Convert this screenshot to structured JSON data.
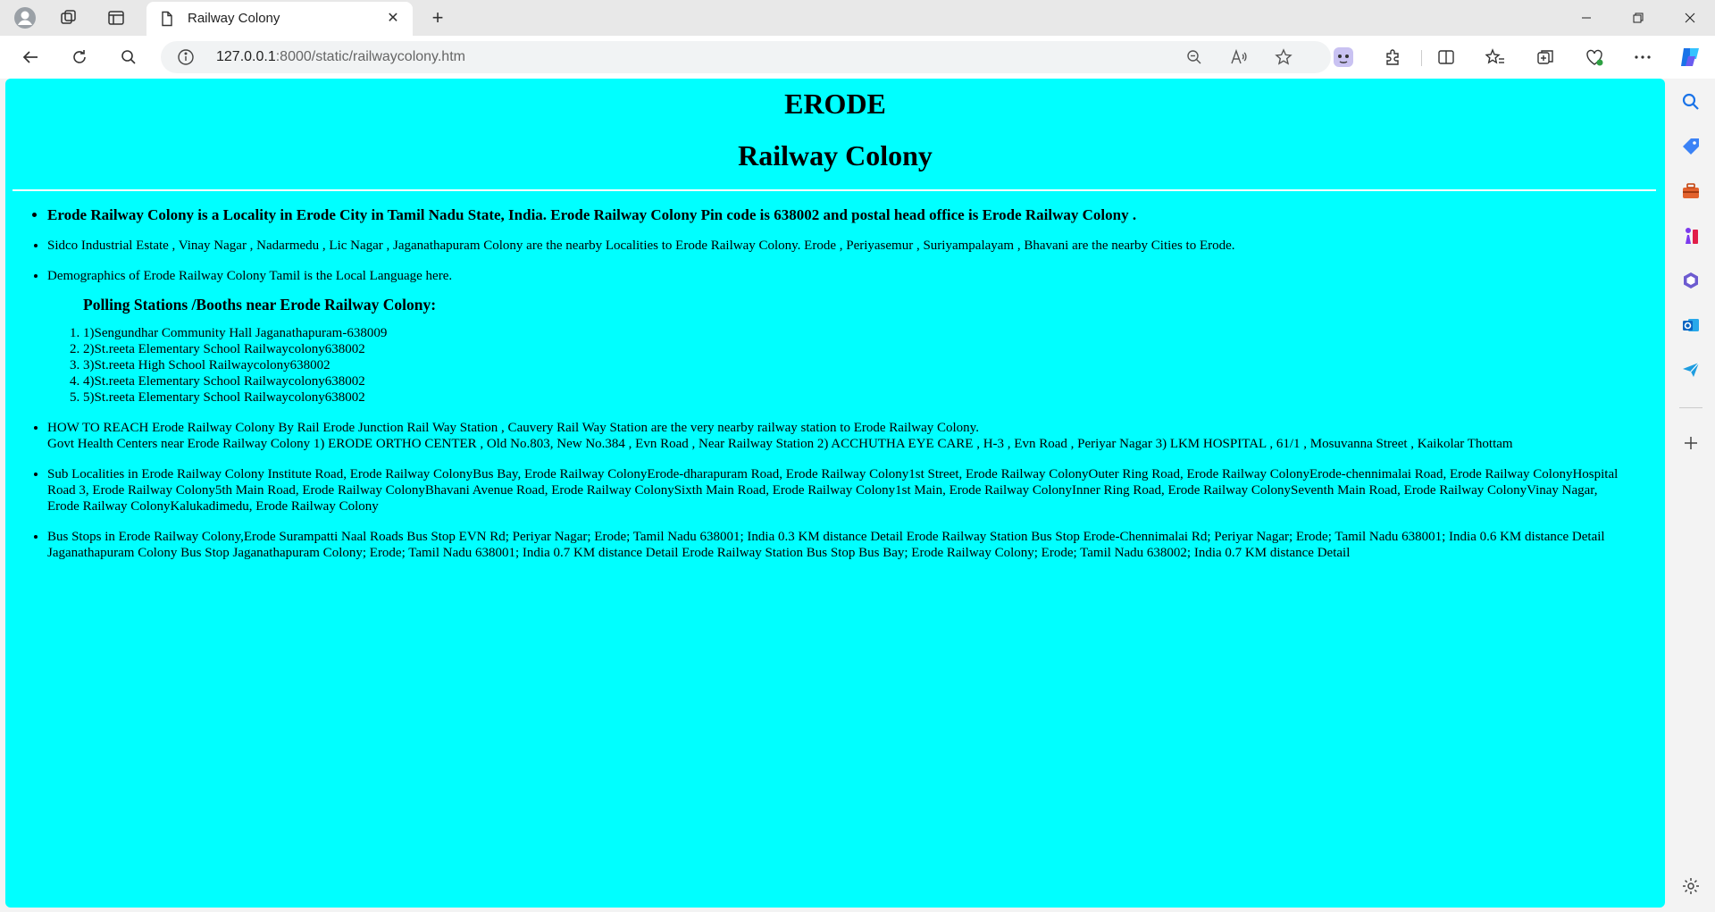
{
  "browser": {
    "tab_title": "Railway Colony",
    "url_host": "127.0.0.1",
    "url_rest": ":8000/static/railwaycolony.htm"
  },
  "page": {
    "heading1": "ERODE",
    "heading2": "Railway Colony",
    "bullets": {
      "intro": "Erode Railway Colony is a Locality in Erode City in Tamil Nadu State, India. Erode Railway Colony Pin code is 638002 and postal head office is Erode Railway Colony .",
      "nearby": "Sidco Industrial Estate , Vinay Nagar , Nadarmedu , Lic Nagar , Jaganathapuram Colony are the nearby Localities to Erode Railway Colony. Erode , Periyasemur , Suriyampalayam , Bhavani are the nearby Cities to Erode.",
      "demographics": "Demographics of Erode Railway Colony Tamil is the Local Language here.",
      "how_to_reach": "HOW TO REACH Erode Railway Colony By Rail Erode Junction Rail Way Station , Cauvery Rail Way Station are the very nearby railway station to Erode Railway Colony.",
      "health_centers": "Govt Health Centers near Erode Railway Colony 1) ERODE ORTHO CENTER , Old No.803, New No.384 , Evn Road , Near Railway Station 2) ACCHUTHA EYE CARE , H-3 , Evn Road , Periyar Nagar 3) LKM HOSPITAL , 61/1 , Mosuvanna Street , Kaikolar Thottam",
      "sub_localities": "Sub Localities in Erode Railway Colony Institute Road, Erode Railway ColonyBus Bay, Erode Railway ColonyErode-dharapuram Road, Erode Railway Colony1st Street, Erode Railway ColonyOuter Ring Road, Erode Railway ColonyErode-chennimalai Road, Erode Railway ColonyHospital Road 3, Erode Railway Colony5th Main Road, Erode Railway ColonyBhavani Avenue Road, Erode Railway ColonySixth Main Road, Erode Railway Colony1st Main, Erode Railway ColonyInner Ring Road, Erode Railway ColonySeventh Main Road, Erode Railway ColonyVinay Nagar, Erode Railway ColonyKalukadimedu, Erode Railway Colony",
      "bus_stops": "Bus Stops in Erode Railway Colony,Erode Surampatti Naal Roads Bus Stop EVN Rd; Periyar Nagar; Erode; Tamil Nadu 638001; India 0.3 KM distance Detail Erode Railway Station Bus Stop Erode-Chennimalai Rd; Periyar Nagar; Erode; Tamil Nadu 638001; India 0.6 KM distance Detail Jaganathapuram Colony Bus Stop Jaganathapuram Colony; Erode; Tamil Nadu 638001; India 0.7 KM distance Detail Erode Railway Station Bus Stop Bus Bay; Erode Railway Colony; Erode; Tamil Nadu 638002; India 0.7 KM distance Detail"
    },
    "polling_title": "Polling Stations /Booths near Erode Railway Colony:",
    "booths": [
      "1)Sengundhar Community Hall Jaganathapuram-638009",
      "2)St.reeta Elementary School Railwaycolony638002",
      "3)St.reeta High School Railwaycolony638002",
      "4)St.reeta Elementary School Railwaycolony638002",
      "5)St.reeta Elementary School Railwaycolony638002"
    ]
  },
  "colors": {
    "page_background": "#00ffff",
    "chrome_background": "#e8e8e8"
  },
  "icons": {
    "titlebar": [
      "profile-icon",
      "workspaces-icon",
      "tab-actions-icon"
    ],
    "navbar": [
      "back-icon",
      "refresh-icon",
      "search-icon"
    ],
    "sidebar": [
      "search-icon",
      "tag-icon",
      "toolbox-icon",
      "chess-icon",
      "copilot-icon",
      "outlook-icon",
      "send-icon",
      "add-icon",
      "settings-icon"
    ]
  }
}
